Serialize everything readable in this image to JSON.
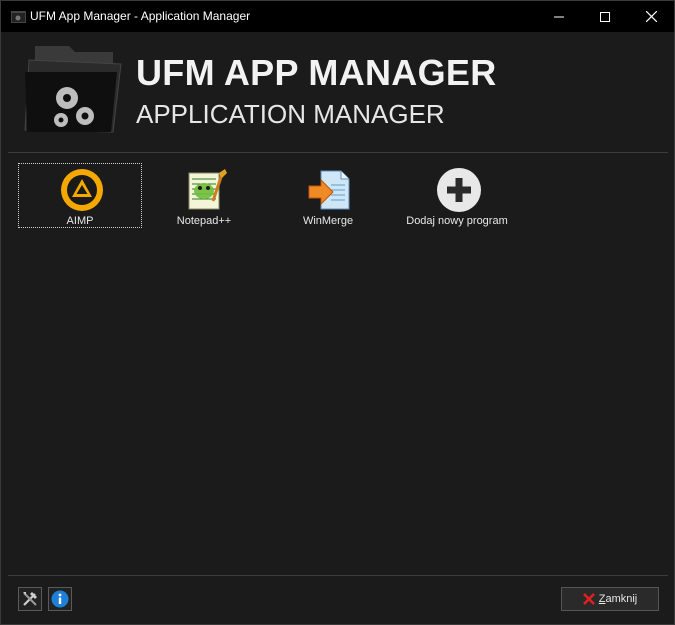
{
  "window": {
    "title": "UFM App Manager - Application Manager",
    "controls": [
      "minimize-icon",
      "maximize-icon",
      "close-icon"
    ]
  },
  "header": {
    "title": "UFM APP MANAGER",
    "subtitle": "APPLICATION MANAGER",
    "logo_icon": "folder-gears-icon"
  },
  "apps": [
    {
      "label": "AIMP",
      "icon": "aimp-icon",
      "selected": true
    },
    {
      "label": "Notepad++",
      "icon": "notepadpp-icon",
      "selected": false
    },
    {
      "label": "WinMerge",
      "icon": "winmerge-icon",
      "selected": false
    },
    {
      "label": "Dodaj nowy program",
      "icon": "add-icon",
      "selected": false
    }
  ],
  "footer": {
    "tools_icon": "tools-icon",
    "info_icon": "info-icon",
    "close_hotkey": "Z",
    "close_rest": "amknij"
  },
  "colors": {
    "background": "#1b1b1b",
    "titlebar": "#000000",
    "text": "#f2f2f2",
    "aimp_orange": "#f5a800",
    "info_blue": "#1e7fd8",
    "close_red": "#e02020"
  }
}
